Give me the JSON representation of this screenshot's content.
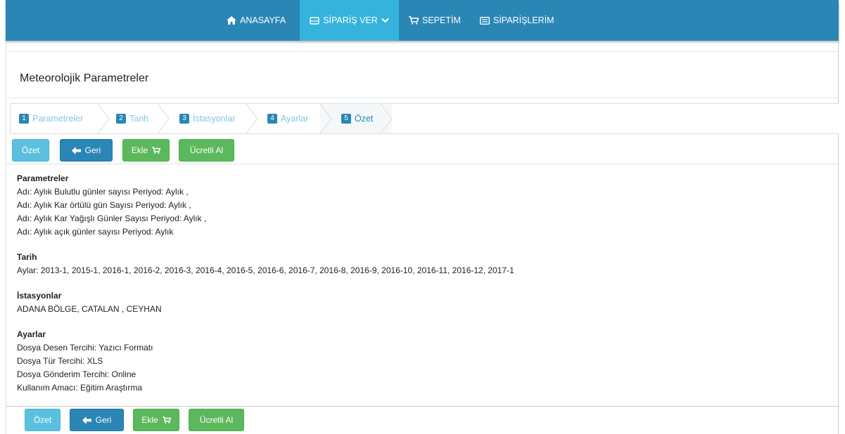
{
  "nav": {
    "items": [
      {
        "label": "ANASAYFA",
        "icon": "home-icon"
      },
      {
        "label": "SİPARİŞ VER",
        "icon": "tablet-icon",
        "active": true
      },
      {
        "label": "SEPETİM",
        "icon": "cart-icon"
      },
      {
        "label": "SİPARİŞLERİM",
        "icon": "list-icon"
      }
    ],
    "colors": {
      "bar": "#2a86b5",
      "active": "#35b3dc"
    }
  },
  "page": {
    "title": "Meteorolojik Parametreler"
  },
  "wizard": {
    "steps": [
      {
        "num": "1",
        "label": "Parametreler"
      },
      {
        "num": "2",
        "label": "Tarih"
      },
      {
        "num": "3",
        "label": "İstasyonlar"
      },
      {
        "num": "4",
        "label": "Ayarlar"
      },
      {
        "num": "5",
        "label": "Özet",
        "active": true
      }
    ]
  },
  "buttons": {
    "summary": "Özet",
    "back": "Geri",
    "add": "Ekle",
    "paid": "Ücretli Al"
  },
  "summary": {
    "parameters": {
      "heading": "Parametreler",
      "lines": [
        "Adı: Aylık Bulutlu günler sayısı Periyod: Aylık ,",
        "Adı: Aylık Kar örtülü gün Sayısı Periyod: Aylık ,",
        "Adı: Aylık Kar Yağışlı Günler Sayısı Periyod: Aylık ,",
        "Adı: Aylık açık günler sayısı Periyod: Aylık"
      ]
    },
    "date": {
      "heading": "Tarih",
      "lines": [
        "Aylar: 2013-1, 2015-1, 2016-1, 2016-2, 2016-3, 2016-4, 2016-5, 2016-6, 2016-7, 2016-8, 2016-9, 2016-10, 2016-11, 2016-12, 2017-1"
      ]
    },
    "stations": {
      "heading": "İstasyonlar",
      "lines": [
        "ADANA BÖLGE, CATALAN , CEYHAN"
      ]
    },
    "settings": {
      "heading": "Ayarlar",
      "lines": [
        "Dosya Desen Tercihi: Yazıcı Formatı",
        "Dosya Tür Tercihi: XLS",
        "Dosya Gönderim Tercihi: Online",
        "Kullanım Amacı: Eğitim Araştırma"
      ]
    }
  }
}
